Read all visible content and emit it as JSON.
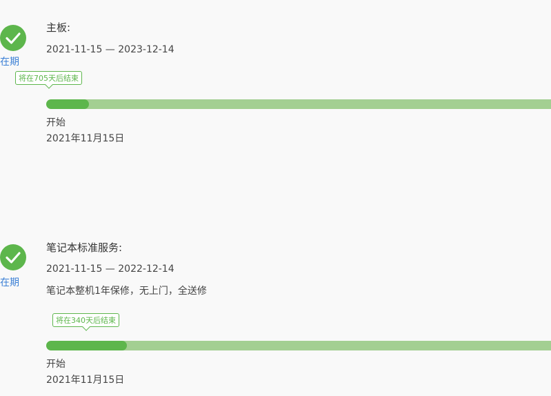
{
  "theme": {
    "accent_green": "#5db64c",
    "track_green": "#a3cf92",
    "status_blue": "#3a7fd5"
  },
  "warranties": [
    {
      "status_icon": "check-circle-icon",
      "status_label": "在期",
      "title": "主板:",
      "date_range": "2021-11-15 — 2023-12-14",
      "description": "",
      "tooltip": "将在705天后结束",
      "progress_fraction": 0.085,
      "start_label": "开始",
      "start_date": "2021年11月15日"
    },
    {
      "status_icon": "check-circle-icon",
      "status_label": "在期",
      "title": "笔记本标准服务:",
      "date_range": "2021-11-15 — 2022-12-14",
      "description": "笔记本整机1年保修，无上门，全送修",
      "tooltip": "将在340天后结束",
      "progress_fraction": 0.16,
      "start_label": "开始",
      "start_date": "2021年11月15日"
    }
  ]
}
